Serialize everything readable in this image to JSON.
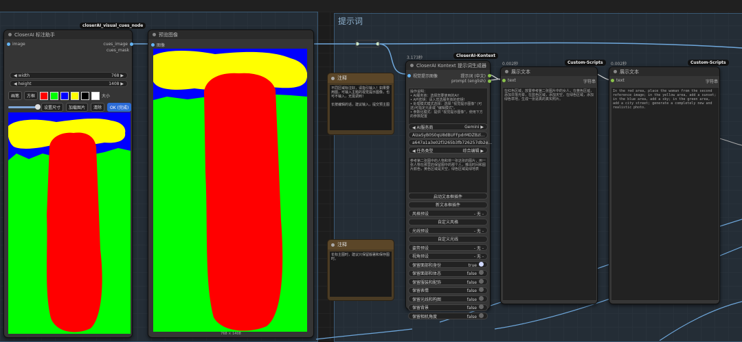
{
  "groups": {
    "prompt_group_title": "提示词"
  },
  "annotator_node": {
    "badge": "closerAI_visual_cues_node",
    "title": "CloserAI 标注助手",
    "input_image": "image",
    "output_cues_image": "cues_image",
    "output_cues_mask": "cues_mask",
    "width_label": "width",
    "width_value": "768",
    "height_label": "height",
    "height_value": "1408",
    "brush_button": "画笔",
    "rect_button": "方框",
    "size_label": "大小",
    "set_size_button": "设置尺寸",
    "load_image_button": "加载图片",
    "clear_button": "清除",
    "ok_button": "OK (完成)",
    "colors": [
      "#ff0000",
      "#00ff00",
      "#0000ff",
      "#ffff00",
      "#000000",
      "#ffffff"
    ]
  },
  "preview_node": {
    "title": "预览图像",
    "input_image": "图像",
    "dimensions": "768 × 1408"
  },
  "note1": {
    "title": "注释",
    "body": "不同区域标注好，请指引输入！如果要用图，可输入主题的视觉提示图像，也可不输入，无需调到！\n\n长按编辑的话，建议输入，提交预主图"
  },
  "note2": {
    "title": "注释",
    "body": "长标主图时，建议只保留版署和保存图时。"
  },
  "kontext_node": {
    "badge": "CloserAI-Kontext",
    "time": "3.173秒",
    "title": "CloserAI Kontext 提示词生成器",
    "input_label": "视觉提示图像",
    "out_chinese": "提示词 (中文)",
    "out_english": "prompt (english)",
    "top_text": "操作说明：\n• AI服务商：选择您要使用的AI！\n• API密钥：请入您选服务商的密钥！\n• 处理模式模式选择：选择 \"视觉提示图像\" (可选)可指定元素或 \"编辑模式\"。\n• 参数化模式：提供 \"视觉提示图像\"，使用下方的参数配置",
    "ai_provider_label": "AI服务商",
    "ai_provider_value": "Gemini",
    "api_key": "AIzaSyB0S0qU8dBUFFpdrMDZBzl...",
    "model_key": "a647a1a3e02f3265b3fb726257db2e...",
    "task_type_label": "任务类型",
    "task_type_value": "综合编辑",
    "prompt_text": "参考第二张图中的人物和将一张这张的图片，用一张人物在那里的保留图中的那个人，推出时间和图片颜色，黄色区域是天空，绿色区域是绿地表",
    "rows": [
      {
        "label": "启动文本框插件",
        "value": ""
      },
      {
        "label": "新文本框插件",
        "value": ""
      },
      {
        "label": "风格预设",
        "value": "- 无 -"
      },
      {
        "label": "自定义风格",
        "value": ""
      },
      {
        "label": "光线预设",
        "value": "- 无 -"
      },
      {
        "label": "自定义光线",
        "value": ""
      },
      {
        "label": "姿势预设",
        "value": "- 无 -"
      },
      {
        "label": "视角预设",
        "value": "- 无 -"
      }
    ],
    "toggles": [
      {
        "label": "保留面部和身份",
        "value": "true"
      },
      {
        "label": "保留面部和体态",
        "value": "false"
      },
      {
        "label": "保留服装和配饰",
        "value": "false"
      },
      {
        "label": "保留表情",
        "value": "false"
      },
      {
        "label": "保留光线和构图",
        "value": "false"
      },
      {
        "label": "保留背景",
        "value": "false"
      },
      {
        "label": "保留相机角度",
        "value": "false"
      }
    ]
  },
  "show_text_node1": {
    "badge": "Custom-Scripts",
    "time": "0.002秒",
    "title": "展示文本",
    "input": "text",
    "output": "字符串",
    "text": "在红色区域，放置参考第二张图片中的女人，在黄色区域，添加日落光晕，在蓝色区域，添加天空，在绿色区域，添加绿色草地，生成一张逼真的真实照片。"
  },
  "show_text_node2": {
    "badge": "Custom-Scripts",
    "time": "0.002秒",
    "title": "展示文本",
    "input": "text",
    "output": "字符串",
    "text": "In the red area, place the woman from the second reference image; in the yellow area, add a sunset; in the blue area, add a sky; in the green area, add a city street; generate a completely new and realistic photo."
  }
}
